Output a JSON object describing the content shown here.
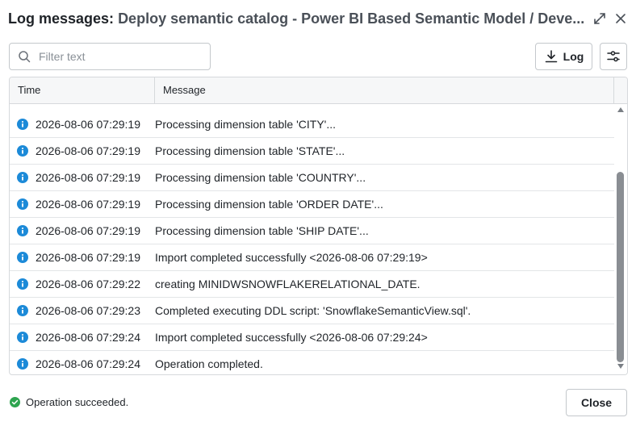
{
  "header": {
    "title_prefix": "Log messages:",
    "title_sub": "Deploy semantic catalog - Power BI Based Semantic Model / Deve..."
  },
  "toolbar": {
    "filter_placeholder": "Filter text",
    "log_label": "Log"
  },
  "table": {
    "columns": [
      "Time",
      "Message"
    ],
    "rows": [
      {
        "time": "2026-08-06 07:29:19",
        "message": "Processing dimension table 'CITY'..."
      },
      {
        "time": "2026-08-06 07:29:19",
        "message": "Processing dimension table 'STATE'..."
      },
      {
        "time": "2026-08-06 07:29:19",
        "message": "Processing dimension table 'COUNTRY'..."
      },
      {
        "time": "2026-08-06 07:29:19",
        "message": "Processing dimension table 'ORDER DATE'..."
      },
      {
        "time": "2026-08-06 07:29:19",
        "message": "Processing dimension table 'SHIP DATE'..."
      },
      {
        "time": "2026-08-06 07:29:19",
        "message": "Import completed successfully <2026-08-06 07:29:19>"
      },
      {
        "time": "2026-08-06 07:29:22",
        "message": "creating MINIDWSNOWFLAKERELATIONAL_DATE."
      },
      {
        "time": "2026-08-06 07:29:23",
        "message": "Completed executing DDL script: 'SnowflakeSemanticView.sql'."
      },
      {
        "time": "2026-08-06 07:29:24",
        "message": "Import completed successfully <2026-08-06 07:29:24>"
      },
      {
        "time": "2026-08-06 07:29:24",
        "message": "Operation completed."
      }
    ]
  },
  "footer": {
    "status_text": "Operation succeeded.",
    "close_label": "Close"
  },
  "colors": {
    "info": "#1c8ad8",
    "success": "#2ea44f",
    "text": "#1f2328"
  },
  "icons": [
    "expand-icon",
    "close-icon",
    "search-icon",
    "download-icon",
    "settings-sliders-icon",
    "info-icon",
    "check-circle-icon"
  ]
}
